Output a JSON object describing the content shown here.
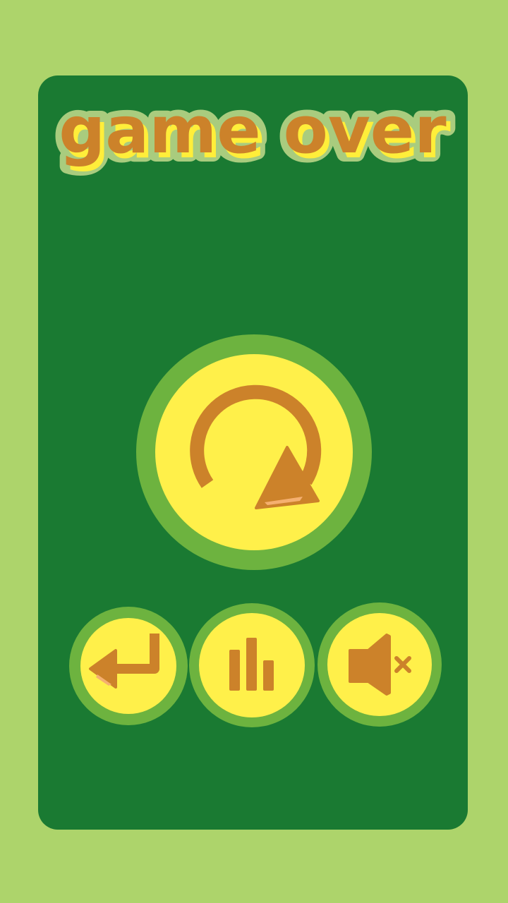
{
  "screen": {
    "title": "game over"
  },
  "buttons": {
    "replay": {
      "icon": "replay-icon"
    },
    "exit": {
      "icon": "return-arrow-icon"
    },
    "leaderboard": {
      "icon": "bar-chart-icon"
    },
    "sound": {
      "icon": "speaker-muted-icon"
    }
  },
  "colors": {
    "page_background": "#add46b",
    "panel": "#1a7a32",
    "button_ring": "#6db33f",
    "button_face": "#fff04a",
    "icon": "#cc822a",
    "title_fill": "#cc822a",
    "title_shadow": "#ffee3a",
    "title_outline": "#a9cc7e"
  }
}
